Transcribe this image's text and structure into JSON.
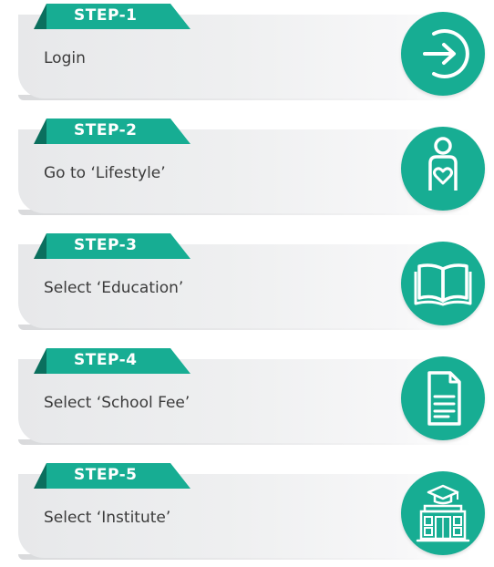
{
  "accent_color": "#17ad93",
  "steps": [
    {
      "label": "STEP-1",
      "text": "Login",
      "icon": "login-arrow-icon"
    },
    {
      "label": "STEP-2",
      "text": "Go to ‘Lifestyle’",
      "icon": "person-heart-icon"
    },
    {
      "label": "STEP-3",
      "text": "Select ‘Education’",
      "icon": "open-book-icon"
    },
    {
      "label": "STEP-4",
      "text": "Select ‘School Fee’",
      "icon": "document-icon"
    },
    {
      "label": "STEP-5",
      "text": "Select ‘Institute’",
      "icon": "school-building-icon"
    }
  ]
}
